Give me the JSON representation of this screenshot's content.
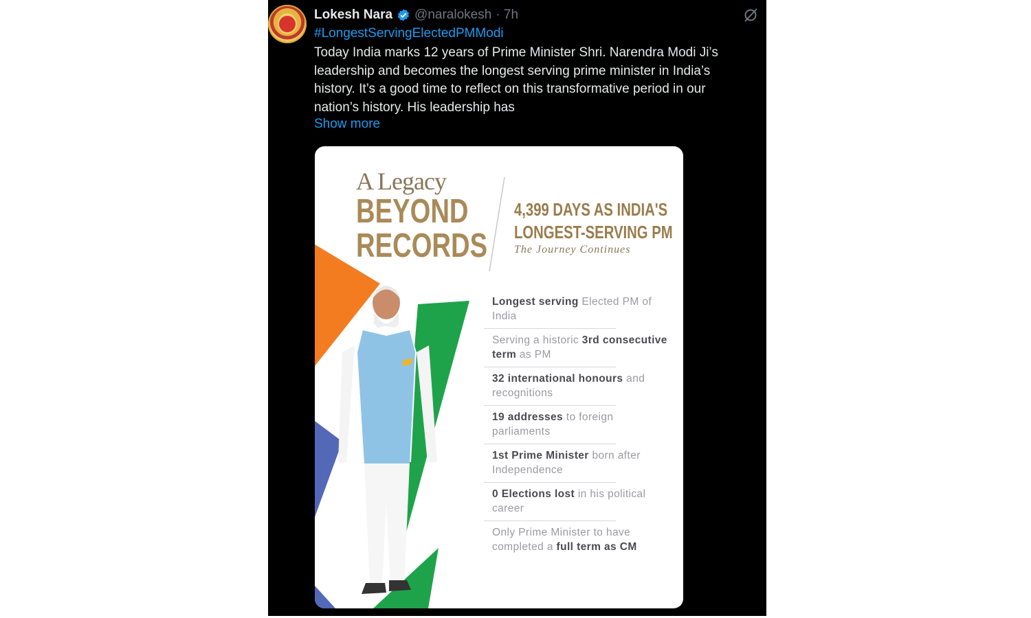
{
  "tweet": {
    "author_name": "Lokesh Nara",
    "handle": "@naralokesh",
    "time": "· 7h",
    "hashtag": "#LongestServingElectedPMModi",
    "text_lines": [
      "Today India marks 12 years of Prime Minister Shri. Narendra Modi Ji’s",
      "leadership and becomes the longest serving prime minister in India’s",
      "history. It’s a good time to reflect on this transformative period in our",
      "nation’s history. His leadership has"
    ],
    "show_more": "Show more"
  },
  "card": {
    "legacy": "A Legacy",
    "beyond_1": "BEYOND",
    "beyond_2": "RECORDS",
    "days_1": "4,399 DAYS AS INDIA'S",
    "days_2": "LONGEST-SERVING PM",
    "journey": "The Journey Continues",
    "stats": [
      {
        "bold": "Longest serving",
        "rest": " Elected PM of India"
      },
      {
        "pre": "Serving a historic ",
        "bold": "3rd consecutive term",
        "rest": " as PM"
      },
      {
        "bold": "32 international honours",
        "rest": " and recognitions"
      },
      {
        "bold": "19 addresses",
        "rest": " to foreign parliaments"
      },
      {
        "bold": "1st Prime Minister",
        "rest": " born after Independence"
      },
      {
        "bold": "0 Elections lost",
        "rest": " in his political career"
      },
      {
        "pre": "Only Prime Minister to have completed a ",
        "bold": "full term as CM",
        "rest": ""
      }
    ]
  },
  "colors": {
    "accent": "#1d9bf0",
    "saffron": "#f47c20",
    "green": "#1fa34a",
    "gold": "#a98a58"
  }
}
